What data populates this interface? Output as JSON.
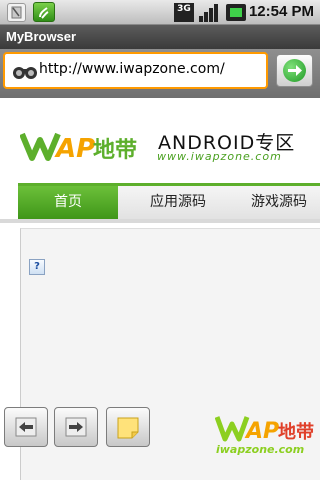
{
  "status_bar": {
    "time": "12:54 PM",
    "network": "3G",
    "icons": [
      "sim-card-icon",
      "notification-icon",
      "signal-icon",
      "battery-icon"
    ]
  },
  "app": {
    "title": "MyBrowser"
  },
  "address_bar": {
    "url": "http://www.iwapzone.com/",
    "go_icon": "go-arrow-icon"
  },
  "site": {
    "logo_wap": "WAP地带",
    "logo_android": "ANDROID专区",
    "logo_url": "www.iwapzone.com",
    "nav_tabs": [
      {
        "label": "首页",
        "active": true
      },
      {
        "label": "应用源码",
        "active": false
      },
      {
        "label": "游戏源码",
        "active": false
      }
    ],
    "broken_image_glyph": "?"
  },
  "toolbar": {
    "back_icon": "back-arrow-icon",
    "forward_icon": "forward-arrow-icon",
    "notes_icon": "note-icon"
  },
  "watermark": {
    "brand": "WAP地带",
    "site": "iwapzone.com"
  },
  "colors": {
    "accent_green": "#5daf2c",
    "url_focus": "#ff9a00"
  }
}
